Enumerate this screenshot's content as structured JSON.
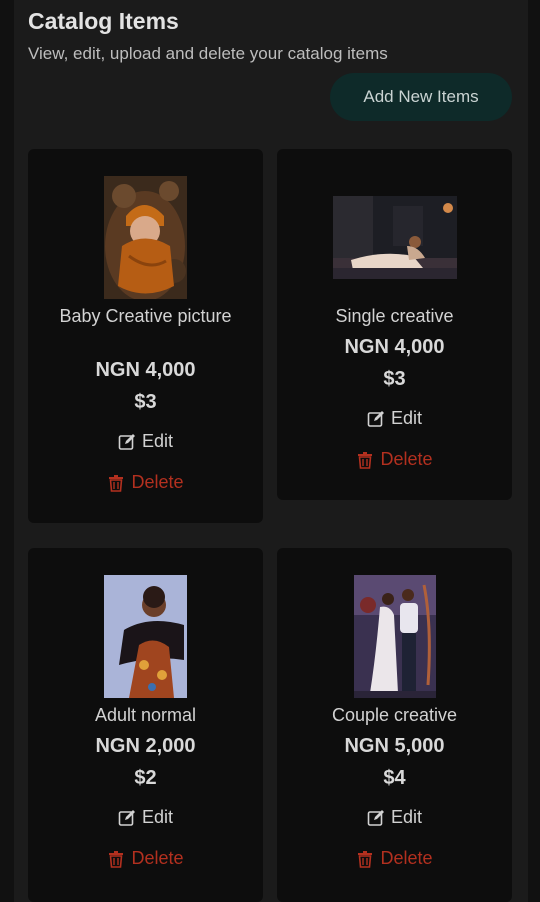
{
  "header": {
    "title": "Catalog Items",
    "subtitle": "View, edit, upload and delete your catalog items",
    "add_button": "Add New Items"
  },
  "items": [
    {
      "name": "Baby Creative picture",
      "price_ngn": "NGN 4,000",
      "price_usd": "$3",
      "edit_label": "Edit",
      "delete_label": "Delete"
    },
    {
      "name": "Single creative",
      "price_ngn": "NGN 4,000",
      "price_usd": "$3",
      "edit_label": "Edit",
      "delete_label": "Delete"
    },
    {
      "name": "Adult normal",
      "price_ngn": "NGN 2,000",
      "price_usd": "$2",
      "edit_label": "Edit",
      "delete_label": "Delete"
    },
    {
      "name": "Couple creative",
      "price_ngn": "NGN 5,000",
      "price_usd": "$4",
      "edit_label": "Edit",
      "delete_label": "Delete"
    }
  ],
  "colors": {
    "background": "#111111",
    "card": "#0d0d0d",
    "accent_button": "#0e2a29",
    "delete": "#b3301f"
  },
  "icons": [
    "edit-icon",
    "trash-icon"
  ]
}
